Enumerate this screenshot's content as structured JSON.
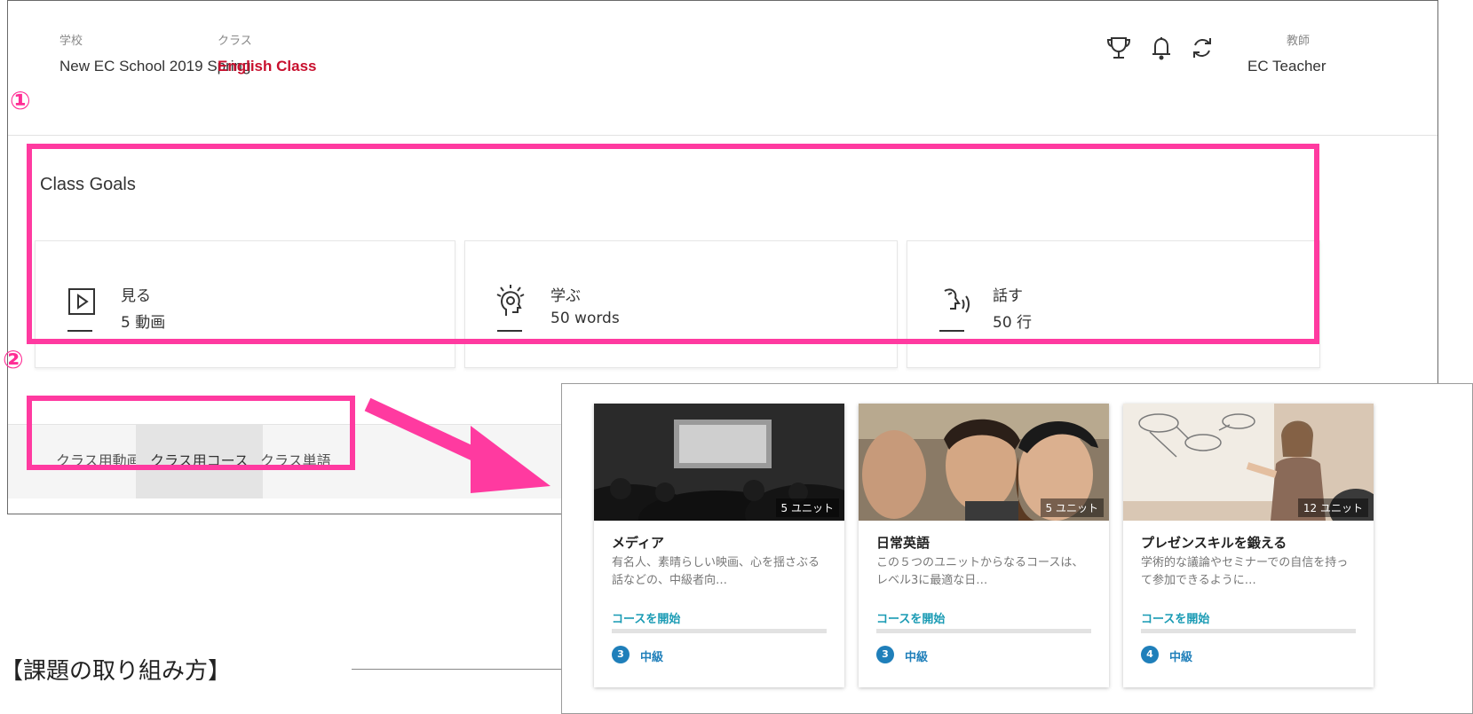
{
  "header": {
    "school_label": "学校",
    "school_value": "New EC School 2019 Spring",
    "class_label": "クラス",
    "class_value": "English Class",
    "teacher_label": "教師",
    "teacher_value": "EC Teacher",
    "icons": [
      "trophy-icon",
      "bell-icon",
      "refresh-icon"
    ]
  },
  "annotations": {
    "marker_1": "①",
    "marker_2": "②",
    "highlight_color": "#ff3aa0"
  },
  "goals": {
    "title": "Class Goals",
    "items": [
      {
        "icon": "video-play-icon",
        "name": "見る",
        "value": "5 動画"
      },
      {
        "icon": "lightbulb-head-icon",
        "name": "学ぶ",
        "value": "50 words"
      },
      {
        "icon": "speaking-head-icon",
        "name": "話す",
        "value": "50 行"
      }
    ]
  },
  "tabs": [
    {
      "label": "クラス用動画",
      "active": false
    },
    {
      "label": "クラス用コース",
      "active": true
    },
    {
      "label": "クラス単語",
      "active": false
    }
  ],
  "courses": [
    {
      "units": "5 ユニット",
      "title": "メディア",
      "desc": "有名人、素晴らしい映画、心を揺さぶる話などの、中級者向…",
      "start": "コースを開始",
      "level_num": "3",
      "level_text": "中級"
    },
    {
      "units": "5 ユニット",
      "title": "日常英語",
      "desc": "この５つのユニットからなるコースは、レベル3に最適な日…",
      "start": "コースを開始",
      "level_num": "3",
      "level_text": "中級"
    },
    {
      "units": "12 ユニット",
      "title": "プレゼンスキルを鍛える",
      "desc": "学術的な議論やセミナーでの自信を持って参加できるように…",
      "start": "コースを開始",
      "level_num": "4",
      "level_text": "中級"
    }
  ],
  "bottom_heading": "【課題の取り組み方】",
  "colors": {
    "class_name": "#c8102e",
    "accent_teal": "#1a9bb4",
    "level_blue": "#1f7fba"
  }
}
